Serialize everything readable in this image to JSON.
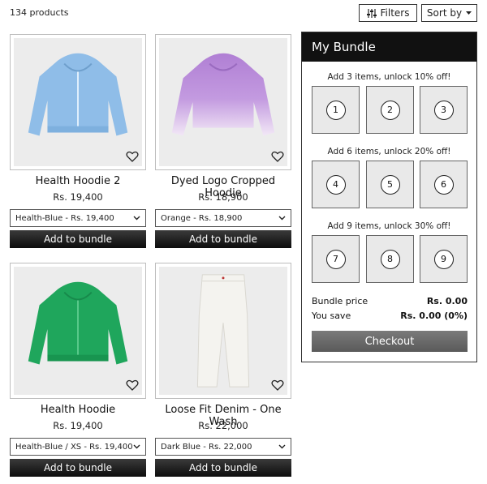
{
  "toolbar": {
    "product_count": "134 products",
    "filters_label": "Filters",
    "sort_label": "Sort by"
  },
  "products": [
    {
      "name": "Health Hoodie 2",
      "price": "Rs. 19,400",
      "variant": "Health-Blue - Rs. 19,400",
      "button": "Add to bundle",
      "color": "#8fbde8"
    },
    {
      "name": "Dyed Logo Cropped Hoodie",
      "price": "Rs. 18,900",
      "variant": "Orange - Rs. 18,900",
      "button": "Add to bundle",
      "color": "#b98fd6"
    },
    {
      "name": "Health Hoodie",
      "price": "Rs. 19,400",
      "variant": "Health-Blue / XS - Rs. 19,400",
      "button": "Add to bundle",
      "color": "#1fa65c"
    },
    {
      "name": "Loose Fit Denim - One Wash",
      "price": "Rs. 22,000",
      "variant": "Dark Blue - Rs. 22,000",
      "button": "Add to bundle",
      "color": "#f4f3ef"
    }
  ],
  "bundle": {
    "title": "My Bundle",
    "tiers": [
      {
        "label": "Add 3 items, unlock 10% off!",
        "slots": [
          "1",
          "2",
          "3"
        ]
      },
      {
        "label": "Add 6 items, unlock 20% off!",
        "slots": [
          "4",
          "5",
          "6"
        ]
      },
      {
        "label": "Add 9 items, unlock 30% off!",
        "slots": [
          "7",
          "8",
          "9"
        ]
      }
    ],
    "price_label": "Bundle price",
    "price_value": "Rs. 0.00",
    "save_label": "You save",
    "save_value": "Rs. 0.00 (0%)",
    "checkout_label": "Checkout"
  },
  "icons": {
    "filters": "sliders-icon",
    "sort": "caret-down-icon",
    "wishlist": "heart-icon",
    "select": "chevron-down-icon"
  }
}
